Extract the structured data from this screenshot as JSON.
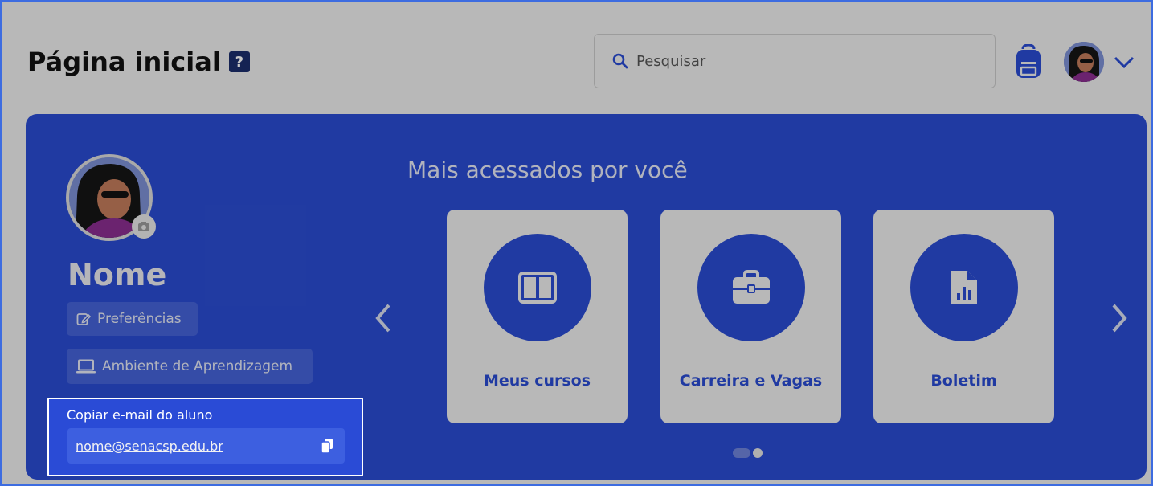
{
  "header": {
    "title": "Página inicial",
    "help_glyph": "?",
    "search_placeholder": "Pesquisar",
    "icons": [
      "search-icon",
      "backpack-icon",
      "avatar",
      "chevron-down-icon"
    ]
  },
  "profile": {
    "name": "Nome",
    "preferences_label": "Preferências",
    "learning_env_label": "Ambiente de Aprendizagem",
    "email_label": "Copiar e-mail do aluno",
    "email_value": "nome@senacsp.edu.br"
  },
  "most_accessed": {
    "title": "Mais acessados por você",
    "cards": [
      {
        "label": "Meus cursos",
        "icon": "columns-icon"
      },
      {
        "label": "Carreira e Vagas",
        "icon": "briefcase-icon"
      },
      {
        "label": "Boletim",
        "icon": "report-chart-icon"
      }
    ],
    "pagination": {
      "pages": 2,
      "active": 2
    }
  },
  "colors": {
    "hero": "#2a4bd0",
    "card": "#ececec",
    "title_dark": "#1c2d6b",
    "highlight_border": "#ffffff"
  }
}
